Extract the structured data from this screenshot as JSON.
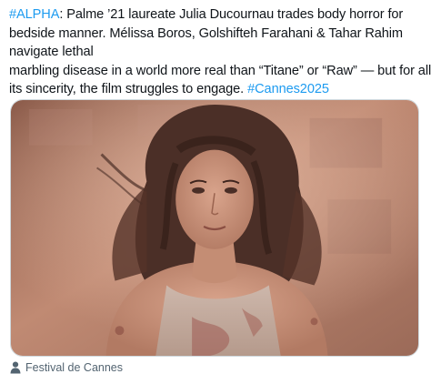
{
  "tweet": {
    "line1": {
      "hashtag": "#ALPHA",
      "text": ": Palme ’21 laureate Julia Ducournau trades body horror for"
    },
    "line2": "bedside manner. Mélissa Boros, Golshifteh Farahani & Tahar Rahim",
    "line3": "navigate lethal",
    "line4": "marbling disease in a world more real than “Titane” or “Raw” — but for all",
    "line5": {
      "text": "its sincerity, the film struggles to engage. ",
      "hashtag": "#Cannes2025"
    }
  },
  "media": {
    "description_icon": "photo"
  },
  "tag": {
    "icon": "person-icon",
    "label": "Festival de Cannes"
  },
  "colors": {
    "text": "#0f1419",
    "link": "#1d9bf0",
    "secondary": "#536471",
    "border": "#cfd9de"
  }
}
